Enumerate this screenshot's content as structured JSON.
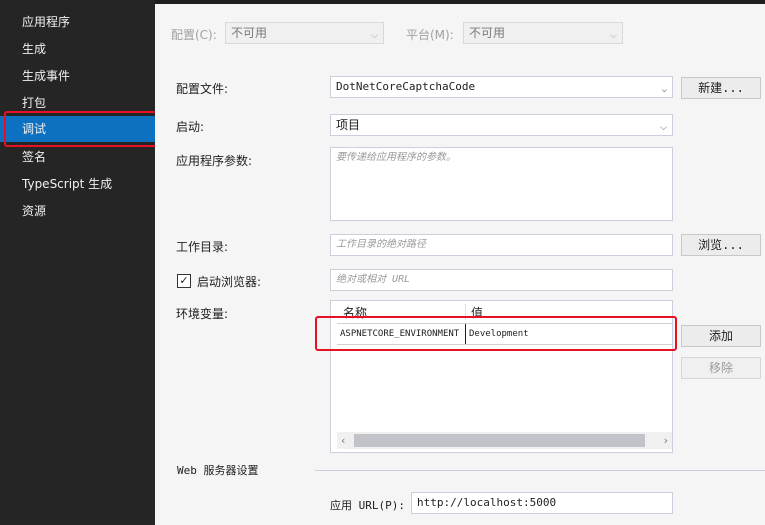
{
  "sidebar": {
    "items": [
      {
        "label": "应用程序"
      },
      {
        "label": "生成"
      },
      {
        "label": "生成事件"
      },
      {
        "label": "打包"
      },
      {
        "label": "调试"
      },
      {
        "label": "签名"
      },
      {
        "label": "TypeScript 生成"
      },
      {
        "label": "资源"
      }
    ],
    "active": "调试"
  },
  "config_bar": {
    "config_label": "配置(C):",
    "config_value": "不可用",
    "platform_label": "平台(M):",
    "platform_value": "不可用"
  },
  "form": {
    "profile_label": "配置文件:",
    "profile_value": "DotNetCoreCaptchaCode",
    "new_button": "新建...",
    "launch_label": "启动:",
    "launch_value": "项目",
    "args_label": "应用程序参数:",
    "args_placeholder": "要传递给应用程序的参数。",
    "workdir_label": "工作目录:",
    "workdir_placeholder": "工作目录的绝对路径",
    "browse_button": "浏览...",
    "launch_browser_label": "启动浏览器:",
    "launch_browser_checked": true,
    "browser_url_placeholder": "绝对或相对 URL",
    "env_label": "环境变量:",
    "env_columns": [
      "名称",
      "值"
    ],
    "env_rows": [
      {
        "name": "ASPNETCORE_ENVIRONMENT",
        "value": "Development"
      }
    ],
    "add_button": "添加",
    "remove_button": "移除",
    "web_server_section": "Web 服务器设置",
    "app_url_label": "应用 URL(P):",
    "app_url_value": "http://localhost:5000"
  },
  "colors": {
    "sidebar_bg": "#252526",
    "active_bg": "#0e70c0",
    "highlight": "#e81123"
  }
}
